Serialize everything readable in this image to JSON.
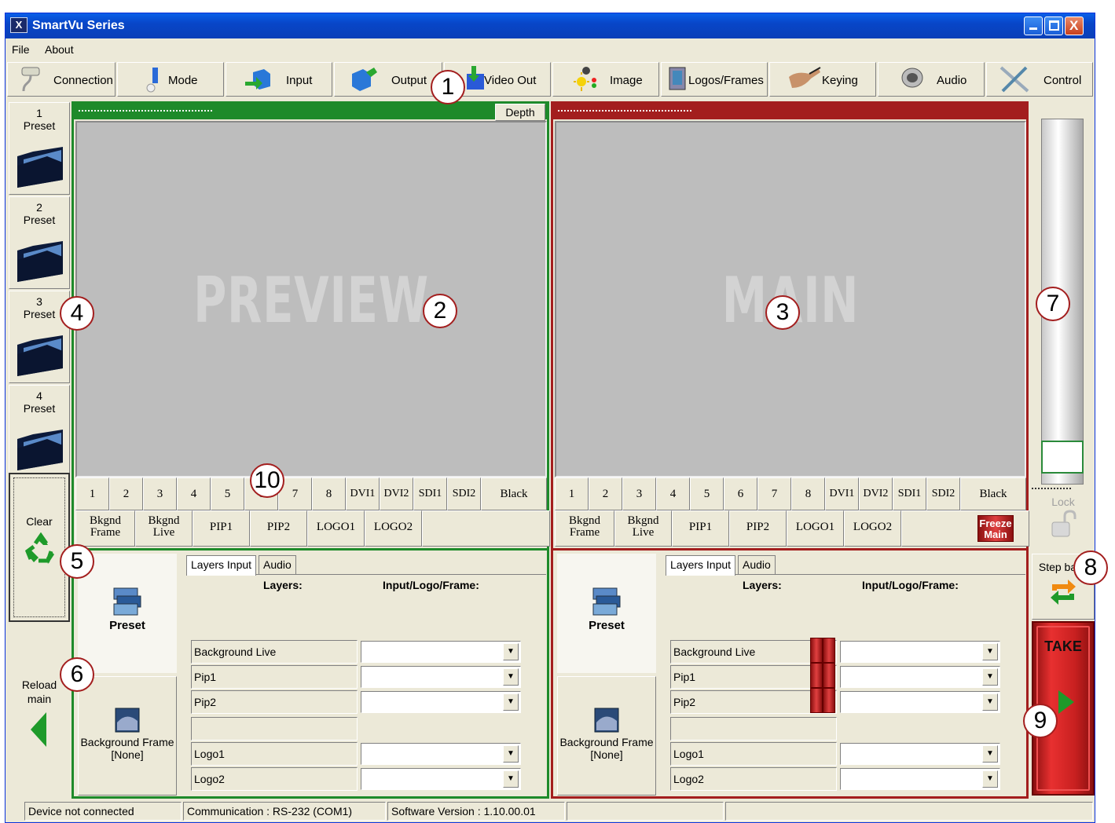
{
  "window": {
    "title": "SmartVu Series",
    "min": "_",
    "max": "□",
    "close": "X"
  },
  "menu": {
    "file": "File",
    "about": "About"
  },
  "toolbar": [
    {
      "label": "Connection",
      "icon": "cable-icon"
    },
    {
      "label": "Mode",
      "icon": "mode-icon"
    },
    {
      "label": "Input",
      "icon": "input-cube-icon"
    },
    {
      "label": "Output",
      "icon": "output-cube-icon"
    },
    {
      "label": "Video Out",
      "icon": "video-out-icon"
    },
    {
      "label": "Image",
      "icon": "sun-icon"
    },
    {
      "label": "Logos/Frames",
      "icon": "logos-frames-icon"
    },
    {
      "label": "Keying",
      "icon": "keying-hand-icon"
    },
    {
      "label": "Audio",
      "icon": "speaker-icon"
    },
    {
      "label": "Control",
      "icon": "tools-icon"
    }
  ],
  "presets": [
    {
      "num": "1",
      "label": "Preset"
    },
    {
      "num": "2",
      "label": "Preset"
    },
    {
      "num": "3",
      "label": "Preset"
    },
    {
      "num": "4",
      "label": "Preset"
    }
  ],
  "clear_label": "Clear",
  "reload_label": "Reload main",
  "preview": {
    "depth_label": "Depth",
    "watermark": "PREVIEW",
    "inputs": [
      "1",
      "2",
      "3",
      "4",
      "5",
      "6",
      "7",
      "8",
      "DVI1",
      "DVI2",
      "SDI1",
      "SDI2"
    ],
    "black_label": "Black",
    "layers": [
      "Bkgnd Frame",
      "Bkgnd Live",
      "PIP1",
      "PIP2",
      "LOGO1",
      "LOGO2"
    ]
  },
  "main": {
    "watermark": "MAIN",
    "inputs": [
      "1",
      "2",
      "3",
      "4",
      "5",
      "6",
      "7",
      "8",
      "DVI1",
      "DVI2",
      "SDI1",
      "SDI2"
    ],
    "black_label": "Black",
    "layers": [
      "Bkgnd Frame",
      "Bkgnd Live",
      "PIP1",
      "PIP2",
      "LOGO1",
      "LOGO2"
    ],
    "freeze_label": "Freeze Main"
  },
  "lower": {
    "preset_label": "Preset",
    "bgframe_label": "Background Frame",
    "bgframe_value": "[None]",
    "tab_layers": "Layers Input",
    "tab_audio": "Audio",
    "col_layers": "Layers:",
    "col_input": "Input/Logo/Frame:",
    "rows": [
      "Background Live",
      "Pip1",
      "Pip2",
      "",
      "Logo1",
      "Logo2"
    ]
  },
  "right": {
    "lock_label": "Lock",
    "stepback_label": "Step back",
    "take_label": "TAKE"
  },
  "status": {
    "device": "Device not connected",
    "comm": "Communication : RS-232 (COM1)",
    "version": "Software Version : 1.10.00.01"
  },
  "callouts": [
    "1",
    "2",
    "3",
    "4",
    "5",
    "6",
    "7",
    "8",
    "9",
    "10"
  ]
}
